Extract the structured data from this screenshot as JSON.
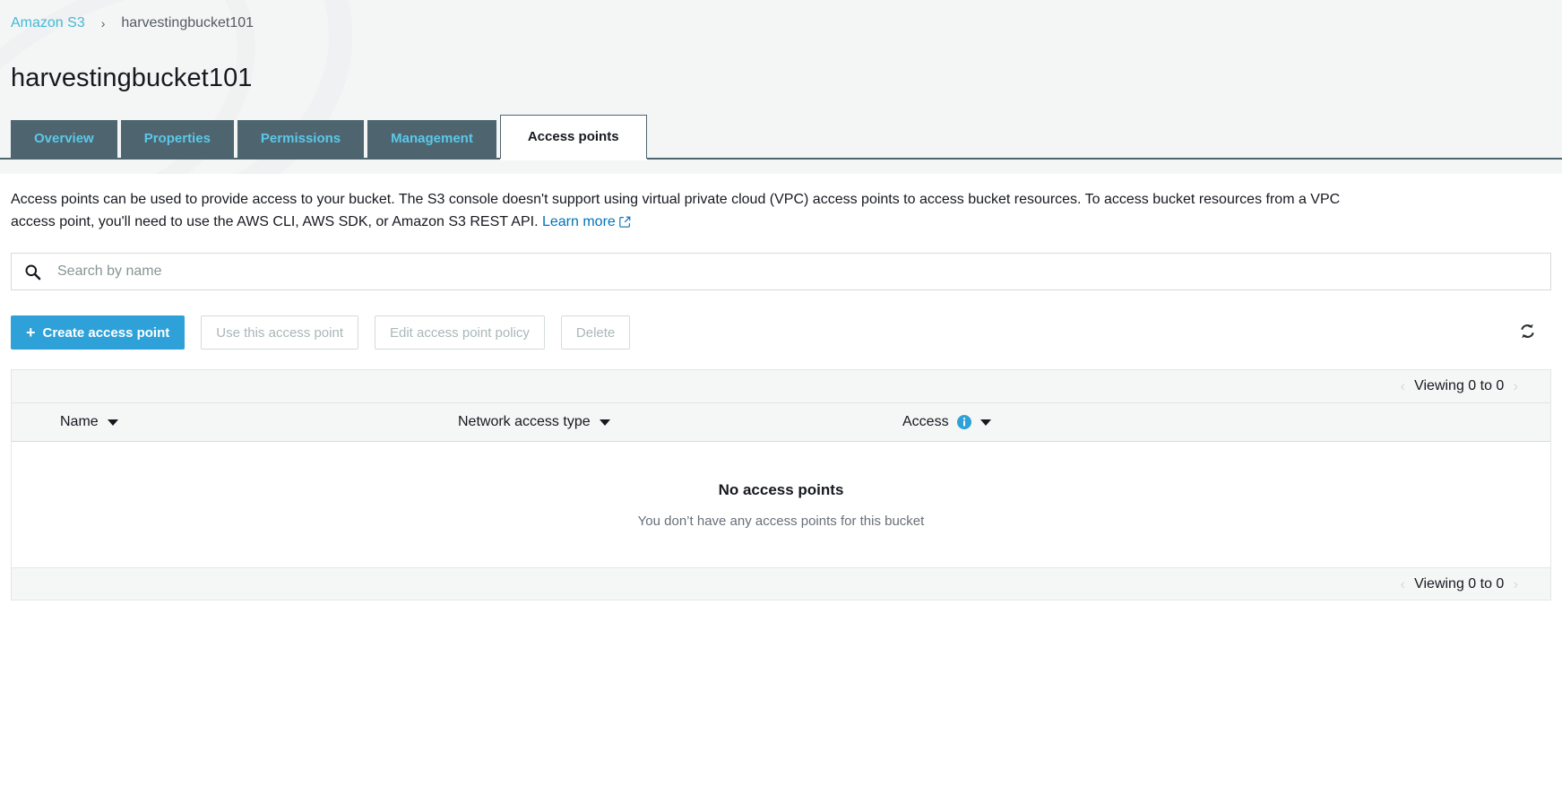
{
  "breadcrumb": {
    "root_label": "Amazon S3",
    "separator": "›",
    "current_label": "harvestingbucket101"
  },
  "page_title": "harvestingbucket101",
  "tabs": [
    {
      "label": "Overview",
      "active": false
    },
    {
      "label": "Properties",
      "active": false
    },
    {
      "label": "Permissions",
      "active": false
    },
    {
      "label": "Management",
      "active": false
    },
    {
      "label": "Access points",
      "active": true
    }
  ],
  "description": {
    "text": "Access points can be used to provide access to your bucket. The S3 console doesn't support using virtual private cloud (VPC) access points to access bucket resources. To access bucket resources from a VPC access point, you'll need to use the AWS CLI, AWS SDK, or Amazon S3 REST API.",
    "link_label": "Learn more",
    "link_icon": "external-link-icon"
  },
  "search": {
    "icon": "search-icon",
    "placeholder": "Search by name",
    "value": ""
  },
  "toolbar": {
    "create_label": "Create access point",
    "create_plus": "+",
    "use_label": "Use this access point",
    "edit_policy_label": "Edit access point policy",
    "delete_label": "Delete",
    "refresh_icon": "refresh-icon"
  },
  "table": {
    "pager_top": "Viewing 0 to 0",
    "pager_bottom": "Viewing 0 to 0",
    "pager_prev": "‹",
    "pager_next": "›",
    "columns": [
      {
        "label": "Name",
        "has_caret": true,
        "has_info": false
      },
      {
        "label": "Network access type",
        "has_caret": true,
        "has_info": false
      },
      {
        "label": "Access",
        "has_caret": true,
        "has_info": true
      }
    ],
    "rows": [],
    "empty_title": "No access points",
    "empty_subtitle": "You don’t have any access points for this bucket"
  },
  "colors": {
    "accent_blue": "#2ea1d8",
    "link_blue": "#0073bb",
    "breadcrumb_blue": "#44b9d6",
    "tab_bg": "#4e6570",
    "tab_text": "#5bc8e8",
    "page_bg": "#f4f5f5",
    "table_header_bg": "#f5f6f6",
    "disabled_text": "#aab7b8"
  }
}
